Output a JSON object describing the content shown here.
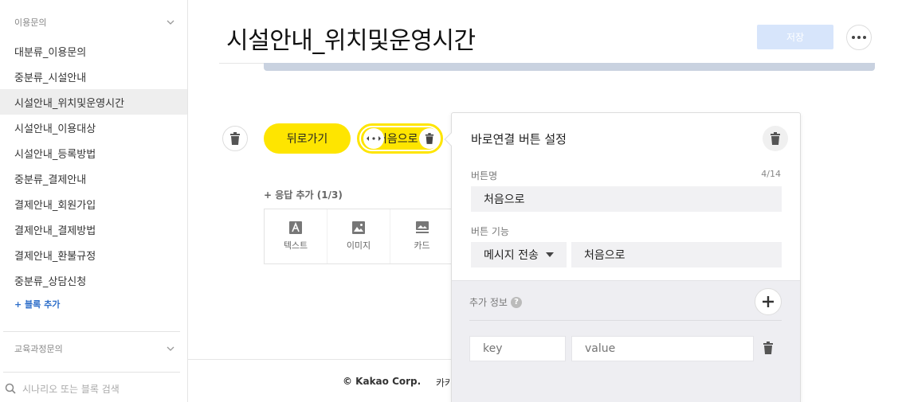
{
  "sidebar": {
    "group1_title": "이용문의",
    "items": [
      {
        "label": "대분류_이용문의"
      },
      {
        "label": "중분류_시설안내"
      },
      {
        "label": "시설안내_위치및운영시간"
      },
      {
        "label": "시설안내_이용대상"
      },
      {
        "label": "시설안내_등록방법"
      },
      {
        "label": "중분류_결제안내"
      },
      {
        "label": "결제안내_회원가입"
      },
      {
        "label": "결제안내_결제방법"
      },
      {
        "label": "결제안내_환불규정"
      },
      {
        "label": "중분류_상담신청"
      }
    ],
    "active_index": 2,
    "add_block_label": "+ 블록 추가",
    "group2_title": "교육과정문의",
    "search_placeholder": "시나리오 또는 블록 검색"
  },
  "header": {
    "title": "시설안내_위치및운영시간",
    "save_label": "저장"
  },
  "quick_replies": {
    "back_label": "뒤로가기",
    "selected_label": "처음으로"
  },
  "response": {
    "add_label": "+ 응답 추가 (1/3)",
    "tools": [
      {
        "label": "텍스트",
        "icon": "text-icon"
      },
      {
        "label": "이미지",
        "icon": "image-icon"
      },
      {
        "label": "카드",
        "icon": "card-icon"
      }
    ]
  },
  "footer": {
    "copyright": "© Kakao Corp.",
    "partial": "카카"
  },
  "panel": {
    "title": "바로연결 버튼 설정",
    "name_label": "버튼명",
    "name_counter": "4/14",
    "name_value": "처음으로",
    "function_label": "버튼 기능",
    "function_select": "메시지 전송",
    "function_value": "처음으로",
    "extra_label": "추가 정보",
    "extra_help": "?",
    "key_placeholder": "key",
    "value_placeholder": "value"
  },
  "colors": {
    "accent_yellow": "#fee500",
    "save_disabled": "#d7e5fb",
    "link_blue": "#2d6ec9"
  }
}
